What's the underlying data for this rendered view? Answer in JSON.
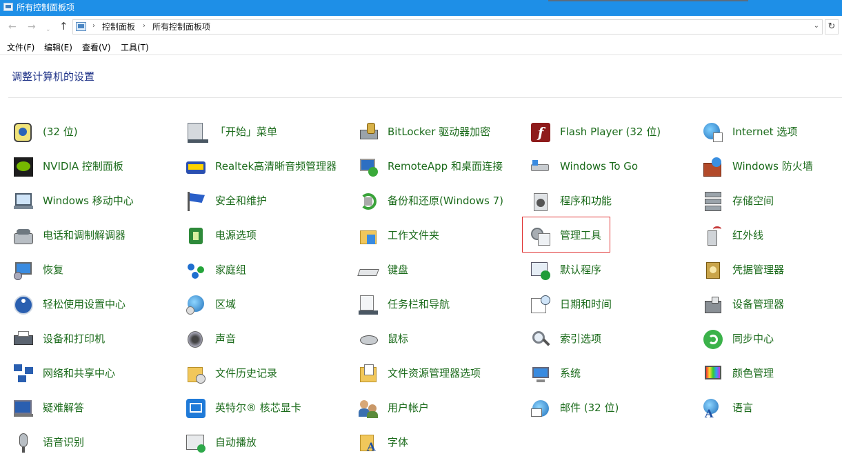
{
  "window": {
    "title": "所有控制面板项"
  },
  "address": {
    "breadcrumbs": [
      "控制面板",
      "所有控制面板项"
    ]
  },
  "nav": {
    "back": "←",
    "forward": "→",
    "recent": "⌄",
    "up": "↑",
    "refresh": "↻",
    "dropdown": "⌄",
    "separator": "›"
  },
  "menu": [
    "文件(F)",
    "编辑(E)",
    "查看(V)",
    "工具(T)"
  ],
  "heading": "调整计算机的设置",
  "items": [
    {
      "label": "(32 位)",
      "icon": "java-icon"
    },
    {
      "label": "「开始」菜单",
      "icon": "taskbar-start-icon"
    },
    {
      "label": "BitLocker 驱动器加密",
      "icon": "bitlocker-icon"
    },
    {
      "label": "Flash Player (32 位)",
      "icon": "flash-icon"
    },
    {
      "label": "Internet 选项",
      "icon": "internet-options-icon"
    },
    {
      "label": "NVIDIA 控制面板",
      "icon": "nvidia-icon"
    },
    {
      "label": "Realtek高清晰音频管理器",
      "icon": "realtek-audio-icon"
    },
    {
      "label": "RemoteApp 和桌面连接",
      "icon": "remoteapp-icon"
    },
    {
      "label": "Windows To Go",
      "icon": "usb-drive-icon"
    },
    {
      "label": "Windows 防火墙",
      "icon": "firewall-icon"
    },
    {
      "label": "Windows 移动中心",
      "icon": "mobility-center-icon"
    },
    {
      "label": "安全和维护",
      "icon": "flag-icon"
    },
    {
      "label": "备份和还原(Windows 7)",
      "icon": "backup-icon"
    },
    {
      "label": "程序和功能",
      "icon": "programs-icon"
    },
    {
      "label": "存储空间",
      "icon": "storage-spaces-icon"
    },
    {
      "label": "电话和调制解调器",
      "icon": "phone-modem-icon"
    },
    {
      "label": "电源选项",
      "icon": "power-options-icon"
    },
    {
      "label": "工作文件夹",
      "icon": "work-folders-icon"
    },
    {
      "label": "管理工具",
      "icon": "admin-tools-icon"
    },
    {
      "label": "红外线",
      "icon": "infrared-icon"
    },
    {
      "label": "恢复",
      "icon": "recovery-icon"
    },
    {
      "label": "家庭组",
      "icon": "homegroup-icon"
    },
    {
      "label": "键盘",
      "icon": "keyboard-icon"
    },
    {
      "label": "默认程序",
      "icon": "default-programs-icon"
    },
    {
      "label": "凭据管理器",
      "icon": "credential-manager-icon"
    },
    {
      "label": "轻松使用设置中心",
      "icon": "ease-of-access-icon"
    },
    {
      "label": "区域",
      "icon": "region-icon"
    },
    {
      "label": "任务栏和导航",
      "icon": "taskbar-icon"
    },
    {
      "label": "日期和时间",
      "icon": "date-time-icon"
    },
    {
      "label": "设备管理器",
      "icon": "device-manager-icon"
    },
    {
      "label": "设备和打印机",
      "icon": "printer-icon"
    },
    {
      "label": "声音",
      "icon": "sound-icon"
    },
    {
      "label": "鼠标",
      "icon": "mouse-icon"
    },
    {
      "label": "索引选项",
      "icon": "indexing-icon"
    },
    {
      "label": "同步中心",
      "icon": "sync-center-icon"
    },
    {
      "label": "网络和共享中心",
      "icon": "network-icon"
    },
    {
      "label": "文件历史记录",
      "icon": "file-history-icon"
    },
    {
      "label": "文件资源管理器选项",
      "icon": "folder-options-icon"
    },
    {
      "label": "系统",
      "icon": "system-icon"
    },
    {
      "label": "颜色管理",
      "icon": "color-management-icon"
    },
    {
      "label": "疑难解答",
      "icon": "troubleshooting-icon"
    },
    {
      "label": "英特尔® 核芯显卡",
      "icon": "intel-graphics-icon"
    },
    {
      "label": "用户帐户",
      "icon": "user-accounts-icon"
    },
    {
      "label": "邮件 (32 位)",
      "icon": "mail-icon"
    },
    {
      "label": "语言",
      "icon": "language-icon"
    },
    {
      "label": "语音识别",
      "icon": "microphone-icon"
    },
    {
      "label": "自动播放",
      "icon": "autoplay-icon"
    },
    {
      "label": "字体",
      "icon": "fonts-icon"
    }
  ],
  "selected_item": "管理工具",
  "colors": {
    "titlebar": "#1e8fe7",
    "link_text": "#1b6b1b",
    "heading_text": "#1e3287",
    "selection_border": "#e03232"
  }
}
